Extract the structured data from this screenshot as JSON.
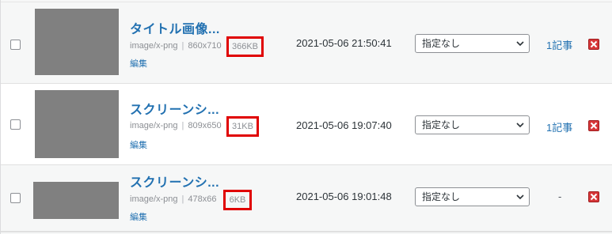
{
  "media_items": [
    {
      "title": "タイトル画像...",
      "mime": "image/x-png",
      "dimensions": "860x710",
      "size": "366KB",
      "edit_label": "編集",
      "date": "2021-05-06 21:50:41",
      "select_value": "指定なし",
      "count": "1記事"
    },
    {
      "title": "スクリーンシ...",
      "mime": "image/x-png",
      "dimensions": "809x650",
      "size": "31KB",
      "edit_label": "編集",
      "date": "2021-05-06 19:07:40",
      "select_value": "指定なし",
      "count": "1記事"
    },
    {
      "title": "スクリーンシ...",
      "mime": "image/x-png",
      "dimensions": "478x66",
      "size": "6KB",
      "edit_label": "編集",
      "date": "2021-05-06 19:01:48",
      "select_value": "指定なし",
      "count": "-"
    }
  ],
  "meta_separator": "|",
  "colors": {
    "link": "#2271b1",
    "highlight_box": "#e00000",
    "delete": "#d63638",
    "thumbnail": "#808080"
  },
  "icons": {
    "delete": "close-icon",
    "dropdown": "chevron-down-icon"
  }
}
